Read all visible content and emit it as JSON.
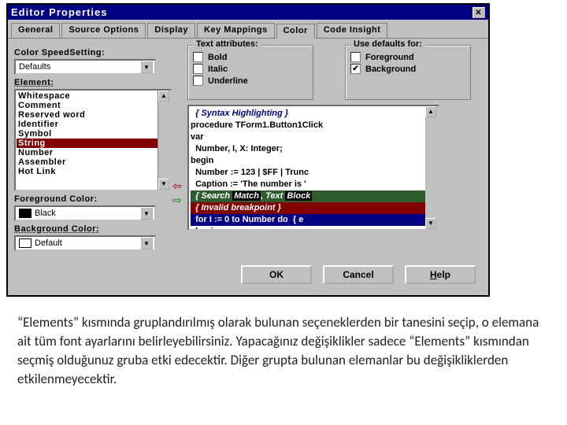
{
  "dialog": {
    "title": "Editor Properties",
    "tabs": [
      "General",
      "Source Options",
      "Display",
      "Key Mappings",
      "Color",
      "Code Insight"
    ],
    "active_tab": 4,
    "speed_label": "Color SpeedSetting:",
    "speed_value": "Defaults",
    "element_label": "Element:",
    "elements": [
      "Whitespace",
      "Comment",
      "Reserved word",
      "Identifier",
      "Symbol",
      "String",
      "Number",
      "Assembler",
      "Hot Link"
    ],
    "selected_element_index": 5,
    "fg_label": "Foreground Color:",
    "fg_value": "Black",
    "bg_label": "Background Color:",
    "bg_value": "Default",
    "attrs_group": "Text attributes:",
    "attrs": {
      "bold": "Bold",
      "italic": "Italic",
      "underline": "Underline"
    },
    "defaults_group": "Use defaults for:",
    "defaults": {
      "fg_label": "Foreground",
      "bg_label": "Background"
    },
    "preview": {
      "l1": "  { Syntax Highlighting }",
      "l2": "procedure TForm1.Button1Click",
      "l3": "var",
      "l4": "  Number, I, X: Integer;",
      "l5": "begin",
      "l6_a": "  Number := 123 | $FF | Trunc",
      "l7": "  Caption := 'The number is '",
      "l8_a": "  { Search ",
      "l8_b": "Match",
      "l8_c": ", Text ",
      "l8_d": "Block",
      "l9": "  { Invalid breakpoint }",
      "l10_a": "  for I := 0 to Number do  { e",
      "l11": "  begin"
    },
    "buttons": {
      "ok": "OK",
      "cancel": "Cancel",
      "help": "Help"
    }
  },
  "caption_text": "“Elements” kısmında gruplandırılmış olarak bulunan seçeneklerden bir tanesini seçip, o elemana ait tüm font ayarlarını belirleyebilirsiniz. Yapacağınız değişiklikler sadece “Elements” kısmından seçmiş olduğunuz gruba etki edecektir. Diğer grupta bulunan elemanlar bu değişikliklerden etkilenmeyecektir."
}
